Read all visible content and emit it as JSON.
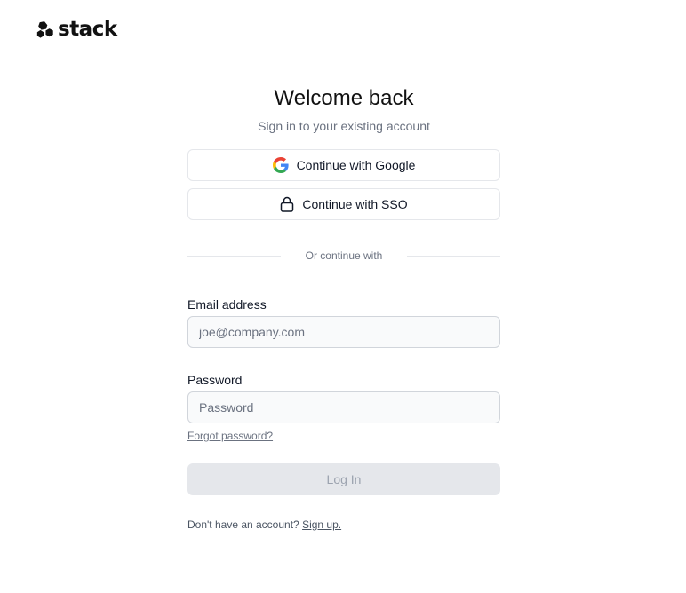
{
  "brand": {
    "name": "stack",
    "logo_icon": "stack-logo-icon"
  },
  "heading": {
    "title": "Welcome back",
    "subtitle": "Sign in to your existing account"
  },
  "oauth": {
    "google_label": "Continue with Google",
    "google_icon": "google-icon",
    "sso_label": "Continue with SSO",
    "sso_icon": "lock-icon"
  },
  "divider": {
    "text": "Or continue with"
  },
  "form": {
    "email_label": "Email address",
    "email_placeholder": "joe@company.com",
    "email_value": "",
    "password_label": "Password",
    "password_placeholder": "Password",
    "password_value": "",
    "forgot_password": "Forgot password?",
    "login_label": "Log In",
    "login_disabled": true
  },
  "signup": {
    "prompt": "Don't have an account?",
    "link": "Sign up."
  },
  "colors": {
    "background": "#ffffff",
    "text_primary": "#111827",
    "text_muted": "#6b7280",
    "border": "#e5e7eb",
    "input_background": "#f9fafb",
    "disabled_button_bg": "#e5e7eb",
    "disabled_button_text": "#9ca3af",
    "google_blue": "#4285F4",
    "google_red": "#EA4335",
    "google_yellow": "#FBBC05",
    "google_green": "#34A853"
  }
}
